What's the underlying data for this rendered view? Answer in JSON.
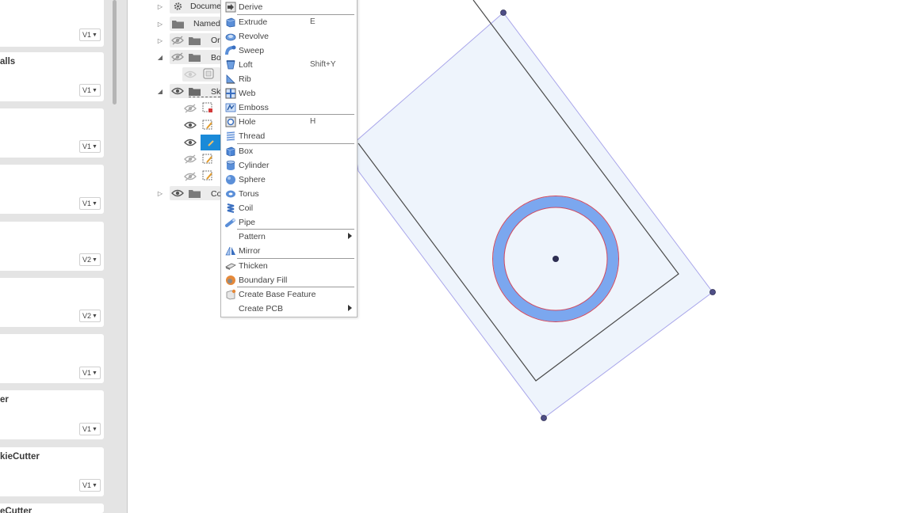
{
  "data_panel": {
    "cards": [
      {
        "name": "",
        "version": "V1"
      },
      {
        "name": "alls",
        "version": "V1"
      },
      {
        "name": "",
        "version": "V1"
      },
      {
        "name": "",
        "version": "V1"
      },
      {
        "name": "",
        "version": "V2"
      },
      {
        "name": "",
        "version": "V2"
      },
      {
        "name": "",
        "version": "V1"
      },
      {
        "name": "er",
        "version": "V1"
      },
      {
        "name": "kieCutter",
        "version": "V1"
      },
      {
        "name": "eCutter",
        "version": ""
      }
    ]
  },
  "browser": {
    "rows": [
      {
        "label": "Documen"
      },
      {
        "label": "Named"
      },
      {
        "label": "Or"
      },
      {
        "label": "Bo"
      },
      {
        "label": ""
      },
      {
        "label": "Sk"
      },
      {
        "label": "Co"
      }
    ]
  },
  "menu": {
    "items": [
      {
        "label": "Derive",
        "shortcut": "",
        "icon": "derive-icon"
      },
      {
        "label": "Extrude",
        "shortcut": "E",
        "icon": "extrude-icon"
      },
      {
        "label": "Revolve",
        "shortcut": "",
        "icon": "revolve-icon"
      },
      {
        "label": "Sweep",
        "shortcut": "",
        "icon": "sweep-icon"
      },
      {
        "label": "Loft",
        "shortcut": "Shift+Y",
        "icon": "loft-icon"
      },
      {
        "label": "Rib",
        "shortcut": "",
        "icon": "rib-icon"
      },
      {
        "label": "Web",
        "shortcut": "",
        "icon": "web-icon"
      },
      {
        "label": "Emboss",
        "shortcut": "",
        "icon": "emboss-icon"
      },
      {
        "label": "Hole",
        "shortcut": "H",
        "icon": "hole-icon"
      },
      {
        "label": "Thread",
        "shortcut": "",
        "icon": "thread-icon"
      },
      {
        "label": "Box",
        "shortcut": "",
        "icon": "box-icon"
      },
      {
        "label": "Cylinder",
        "shortcut": "",
        "icon": "cylinder-icon"
      },
      {
        "label": "Sphere",
        "shortcut": "",
        "icon": "sphere-icon"
      },
      {
        "label": "Torus",
        "shortcut": "",
        "icon": "torus-icon"
      },
      {
        "label": "Coil",
        "shortcut": "",
        "icon": "coil-icon"
      },
      {
        "label": "Pipe",
        "shortcut": "",
        "icon": "pipe-icon"
      },
      {
        "label": "Pattern",
        "shortcut": "",
        "icon": ""
      },
      {
        "label": "Mirror",
        "shortcut": "",
        "icon": "mirror-icon"
      },
      {
        "label": "Thicken",
        "shortcut": "",
        "icon": "thicken-icon"
      },
      {
        "label": "Boundary Fill",
        "shortcut": "",
        "icon": "boundary-fill-icon"
      },
      {
        "label": "Create Base Feature",
        "shortcut": "",
        "icon": "base-feature-icon"
      },
      {
        "label": "Create PCB",
        "shortcut": "",
        "icon": ""
      }
    ]
  },
  "colors": {
    "accent_blue": "#1a8ad8",
    "profile_fill": "#eef4fc",
    "ring_fill": "#7ba7ef",
    "ring_edge": "#d0485e"
  }
}
